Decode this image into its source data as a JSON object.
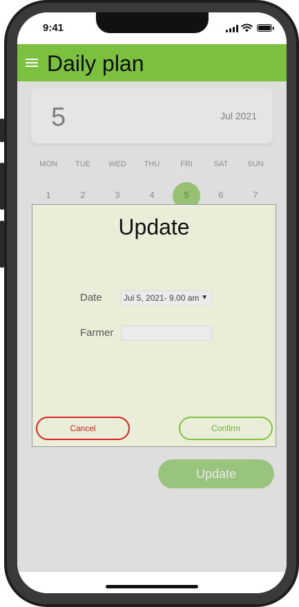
{
  "status_bar": {
    "time": "9:41"
  },
  "app_bar": {
    "title": "Daily plan",
    "menu_icon": "hamburger-menu-icon"
  },
  "date_card": {
    "day": "5",
    "month_year": "Jul 2021"
  },
  "calendar": {
    "weekdays": [
      "MON",
      "TUE",
      "WED",
      "THU",
      "FRI",
      "SAT",
      "SUN"
    ],
    "days": [
      "1",
      "2",
      "3",
      "4",
      "5",
      "6",
      "7"
    ],
    "selected_day": "5"
  },
  "dialog": {
    "title": "Update",
    "date_label": "Date",
    "date_value": "Jul 5, 2021- 9.00 am",
    "farmer_label": "Farmer",
    "farmer_value": "",
    "cancel_label": "Cancel",
    "confirm_label": "Confirm"
  },
  "update_button": {
    "label": "Update"
  },
  "colors": {
    "accent_green": "#7bc03f",
    "dialog_bg": "#eaeed8",
    "cancel_red": "#d92020"
  }
}
